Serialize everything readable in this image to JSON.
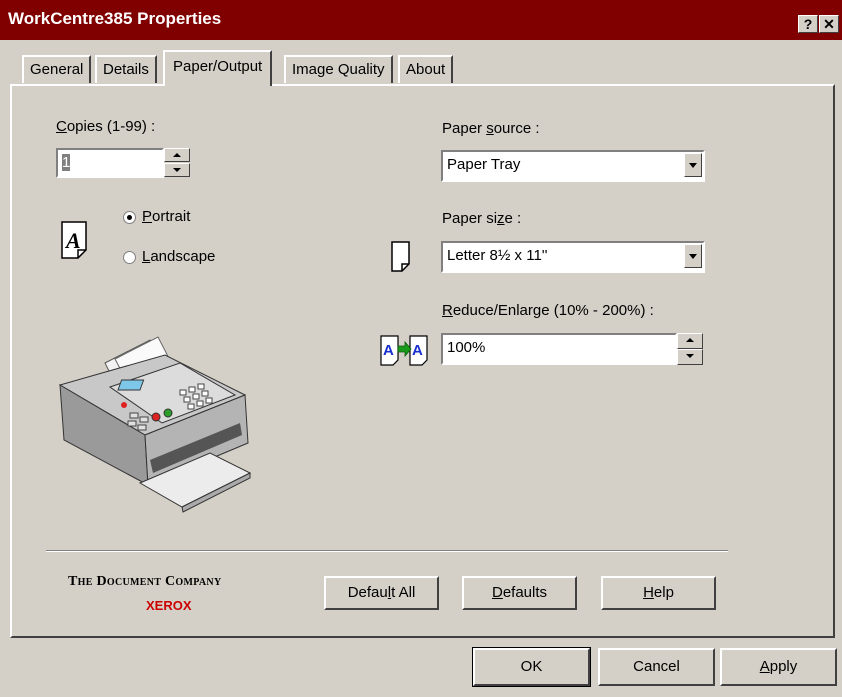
{
  "window": {
    "title": "WorkCentre385 Properties",
    "help_btn": "?",
    "close_btn": "✕"
  },
  "tabs": [
    {
      "label": "General"
    },
    {
      "label": "Details"
    },
    {
      "label": "Paper/Output"
    },
    {
      "label": "Image Quality"
    },
    {
      "label": "About"
    }
  ],
  "copies": {
    "label_ul": "C",
    "label_rest": "opies (1-99) :",
    "value": "1"
  },
  "orientation": {
    "portrait_ul": "P",
    "portrait_rest": "ortrait",
    "landscape_ul": "L",
    "landscape_rest": "andscape",
    "selected": "Portrait"
  },
  "paper_source": {
    "label_pre": "Paper ",
    "label_ul": "s",
    "label_rest": "ource :",
    "value": "Paper Tray"
  },
  "paper_size": {
    "label_pre": "Paper si",
    "label_ul": "z",
    "label_rest": "e :",
    "value": "Letter 8½ x 11''"
  },
  "reduce_enlarge": {
    "label_ul": "R",
    "label_rest": "educe/Enlarge (10% - 200%) :",
    "value": "100%"
  },
  "branding": {
    "line1": "The Document Company",
    "line2": "XEROX",
    "accent": "#cc0000"
  },
  "panel_buttons": {
    "default_all_pre": "Defau",
    "default_all_ul": "l",
    "default_all_rest": "t All",
    "defaults_ul": "D",
    "defaults_rest": "efaults",
    "help_ul": "H",
    "help_rest": "elp"
  },
  "dialog_buttons": {
    "ok": "OK",
    "cancel": "Cancel",
    "apply_ul": "A",
    "apply_rest": "pply"
  },
  "colors": {
    "title_bar": "#800000",
    "face": "#d4d0c8"
  },
  "icons": {
    "portrait": "portrait-page-icon",
    "paper": "paper-page-icon",
    "reduce": "a-to-a-scale-icon",
    "printer": "fax-machine-icon"
  }
}
